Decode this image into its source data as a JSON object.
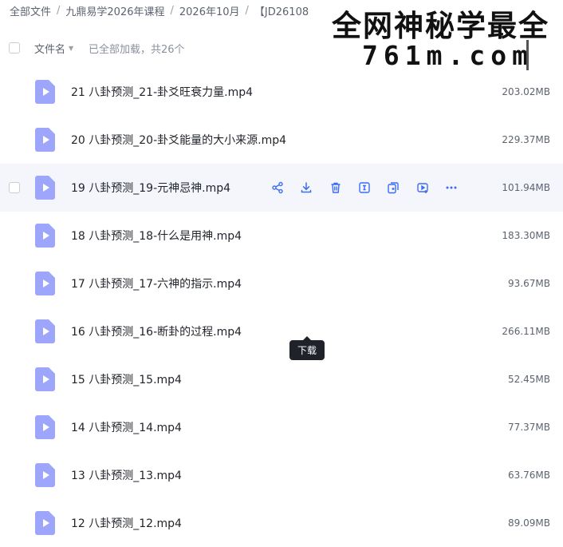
{
  "breadcrumb": [
    {
      "label": "全部文件"
    },
    {
      "label": "九鼎易学2026年课程"
    },
    {
      "label": "2026年10月"
    },
    {
      "label": "【JD26108"
    }
  ],
  "watermark": {
    "line1": "全网神秘学最全",
    "line2": "761m.com"
  },
  "list_header": {
    "column_name": "文件名",
    "load_status": "已全部加载，共26个"
  },
  "tooltip": {
    "text": "下载"
  },
  "row_actions": [
    {
      "icon": "share-icon"
    },
    {
      "icon": "download-icon"
    },
    {
      "icon": "delete-icon"
    },
    {
      "icon": "rename-icon"
    },
    {
      "icon": "copy-icon"
    },
    {
      "icon": "video-icon"
    },
    {
      "icon": "more-icon"
    }
  ],
  "files": [
    {
      "name": "21 八卦预测_21-卦爻旺衰力量.mp4",
      "size": "203.02MB"
    },
    {
      "name": "20 八卦预测_20-卦爻能量的大小来源.mp4",
      "size": "229.37MB"
    },
    {
      "name": "19 八卦预测_19-元神忌神.mp4",
      "size": "101.94MB"
    },
    {
      "name": "18 八卦预测_18-什么是用神.mp4",
      "size": "183.30MB"
    },
    {
      "name": "17 八卦预测_17-六神的指示.mp4",
      "size": "93.67MB"
    },
    {
      "name": "16 八卦预测_16-断卦的过程.mp4",
      "size": "266.11MB"
    },
    {
      "name": "15 八卦预测_15.mp4",
      "size": "52.45MB"
    },
    {
      "name": "14 八卦预测_14.mp4",
      "size": "77.37MB"
    },
    {
      "name": "13 八卦预测_13.mp4",
      "size": "63.76MB"
    },
    {
      "name": "12 八卦预测_12.mp4",
      "size": "89.09MB"
    }
  ],
  "colors": {
    "accent": "#7a84f5",
    "hover_bg": "#f4f6fb",
    "icon_blue": "#3b6cf6"
  }
}
